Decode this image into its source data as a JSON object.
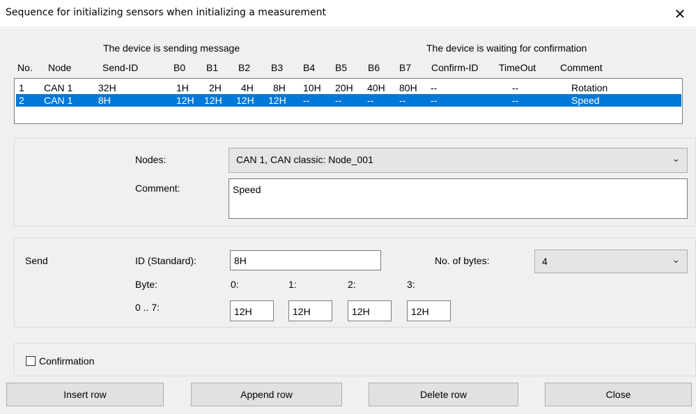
{
  "window": {
    "title": "Sequence for initializing sensors when initializing a measurement",
    "close_glyph": "✕"
  },
  "table": {
    "group_sending": "The device is sending message",
    "group_waiting": "The device is waiting for confirmation",
    "columns": [
      "No.",
      "Node",
      "Send-ID",
      "B0",
      "B1",
      "B2",
      "B3",
      "B4",
      "B5",
      "B6",
      "B7",
      "Confirm-ID",
      "TimeOut",
      "Comment"
    ],
    "rows": [
      {
        "no": "1",
        "node": "CAN 1",
        "send_id": "32H",
        "b0": "1H",
        "b1": "2H",
        "b2": "4H",
        "b3": "8H",
        "b4": "10H",
        "b5": "20H",
        "b6": "40H",
        "b7": "80H",
        "confirm_id": "--",
        "timeout": "--",
        "comment": "Rotation"
      },
      {
        "no": "2",
        "node": "CAN 1",
        "send_id": "8H",
        "b0": "12H",
        "b1": "12H",
        "b2": "12H",
        "b3": "12H",
        "b4": "--",
        "b5": "--",
        "b6": "--",
        "b7": "--",
        "confirm_id": "--",
        "timeout": "--",
        "comment": "Speed"
      }
    ],
    "selected_row": 1
  },
  "details": {
    "nodes_label": "Nodes:",
    "nodes_value": "CAN 1, CAN classic: Node_001",
    "comment_label": "Comment:",
    "comment_value": "Speed"
  },
  "send": {
    "title": "Send",
    "id_label": "ID (Standard):",
    "id_value": "8H",
    "bytes_label": "No. of bytes:",
    "bytes_value": "4",
    "byte_label": "Byte:",
    "range_label": "0 .. 7:",
    "byte_indices": [
      "0:",
      "1:",
      "2:",
      "3:"
    ],
    "byte_values": [
      "12H",
      "12H",
      "12H",
      "12H"
    ]
  },
  "confirmation": {
    "label": "Confirmation",
    "checked": false
  },
  "buttons": {
    "insert": "Insert row",
    "append": "Append row",
    "delete": "Delete row",
    "close": "Close"
  },
  "icons": {
    "dropdown": "chevron-down-icon",
    "close": "close-icon"
  }
}
